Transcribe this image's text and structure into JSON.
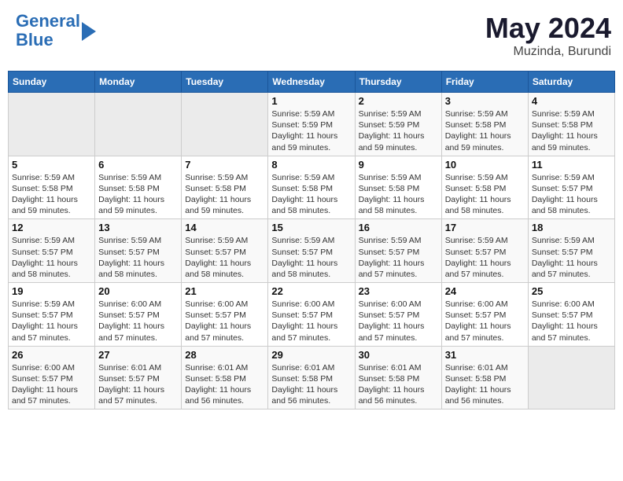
{
  "header": {
    "logo_line1": "General",
    "logo_line2": "Blue",
    "month_year": "May 2024",
    "location": "Muzinda, Burundi"
  },
  "days_of_week": [
    "Sunday",
    "Monday",
    "Tuesday",
    "Wednesday",
    "Thursday",
    "Friday",
    "Saturday"
  ],
  "weeks": [
    [
      {
        "day": "",
        "info": ""
      },
      {
        "day": "",
        "info": ""
      },
      {
        "day": "",
        "info": ""
      },
      {
        "day": "1",
        "info": "Sunrise: 5:59 AM\nSunset: 5:59 PM\nDaylight: 11 hours\nand 59 minutes."
      },
      {
        "day": "2",
        "info": "Sunrise: 5:59 AM\nSunset: 5:59 PM\nDaylight: 11 hours\nand 59 minutes."
      },
      {
        "day": "3",
        "info": "Sunrise: 5:59 AM\nSunset: 5:58 PM\nDaylight: 11 hours\nand 59 minutes."
      },
      {
        "day": "4",
        "info": "Sunrise: 5:59 AM\nSunset: 5:58 PM\nDaylight: 11 hours\nand 59 minutes."
      }
    ],
    [
      {
        "day": "5",
        "info": "Sunrise: 5:59 AM\nSunset: 5:58 PM\nDaylight: 11 hours\nand 59 minutes."
      },
      {
        "day": "6",
        "info": "Sunrise: 5:59 AM\nSunset: 5:58 PM\nDaylight: 11 hours\nand 59 minutes."
      },
      {
        "day": "7",
        "info": "Sunrise: 5:59 AM\nSunset: 5:58 PM\nDaylight: 11 hours\nand 59 minutes."
      },
      {
        "day": "8",
        "info": "Sunrise: 5:59 AM\nSunset: 5:58 PM\nDaylight: 11 hours\nand 58 minutes."
      },
      {
        "day": "9",
        "info": "Sunrise: 5:59 AM\nSunset: 5:58 PM\nDaylight: 11 hours\nand 58 minutes."
      },
      {
        "day": "10",
        "info": "Sunrise: 5:59 AM\nSunset: 5:58 PM\nDaylight: 11 hours\nand 58 minutes."
      },
      {
        "day": "11",
        "info": "Sunrise: 5:59 AM\nSunset: 5:57 PM\nDaylight: 11 hours\nand 58 minutes."
      }
    ],
    [
      {
        "day": "12",
        "info": "Sunrise: 5:59 AM\nSunset: 5:57 PM\nDaylight: 11 hours\nand 58 minutes."
      },
      {
        "day": "13",
        "info": "Sunrise: 5:59 AM\nSunset: 5:57 PM\nDaylight: 11 hours\nand 58 minutes."
      },
      {
        "day": "14",
        "info": "Sunrise: 5:59 AM\nSunset: 5:57 PM\nDaylight: 11 hours\nand 58 minutes."
      },
      {
        "day": "15",
        "info": "Sunrise: 5:59 AM\nSunset: 5:57 PM\nDaylight: 11 hours\nand 58 minutes."
      },
      {
        "day": "16",
        "info": "Sunrise: 5:59 AM\nSunset: 5:57 PM\nDaylight: 11 hours\nand 57 minutes."
      },
      {
        "day": "17",
        "info": "Sunrise: 5:59 AM\nSunset: 5:57 PM\nDaylight: 11 hours\nand 57 minutes."
      },
      {
        "day": "18",
        "info": "Sunrise: 5:59 AM\nSunset: 5:57 PM\nDaylight: 11 hours\nand 57 minutes."
      }
    ],
    [
      {
        "day": "19",
        "info": "Sunrise: 5:59 AM\nSunset: 5:57 PM\nDaylight: 11 hours\nand 57 minutes."
      },
      {
        "day": "20",
        "info": "Sunrise: 6:00 AM\nSunset: 5:57 PM\nDaylight: 11 hours\nand 57 minutes."
      },
      {
        "day": "21",
        "info": "Sunrise: 6:00 AM\nSunset: 5:57 PM\nDaylight: 11 hours\nand 57 minutes."
      },
      {
        "day": "22",
        "info": "Sunrise: 6:00 AM\nSunset: 5:57 PM\nDaylight: 11 hours\nand 57 minutes."
      },
      {
        "day": "23",
        "info": "Sunrise: 6:00 AM\nSunset: 5:57 PM\nDaylight: 11 hours\nand 57 minutes."
      },
      {
        "day": "24",
        "info": "Sunrise: 6:00 AM\nSunset: 5:57 PM\nDaylight: 11 hours\nand 57 minutes."
      },
      {
        "day": "25",
        "info": "Sunrise: 6:00 AM\nSunset: 5:57 PM\nDaylight: 11 hours\nand 57 minutes."
      }
    ],
    [
      {
        "day": "26",
        "info": "Sunrise: 6:00 AM\nSunset: 5:57 PM\nDaylight: 11 hours\nand 57 minutes."
      },
      {
        "day": "27",
        "info": "Sunrise: 6:01 AM\nSunset: 5:57 PM\nDaylight: 11 hours\nand 57 minutes."
      },
      {
        "day": "28",
        "info": "Sunrise: 6:01 AM\nSunset: 5:58 PM\nDaylight: 11 hours\nand 56 minutes."
      },
      {
        "day": "29",
        "info": "Sunrise: 6:01 AM\nSunset: 5:58 PM\nDaylight: 11 hours\nand 56 minutes."
      },
      {
        "day": "30",
        "info": "Sunrise: 6:01 AM\nSunset: 5:58 PM\nDaylight: 11 hours\nand 56 minutes."
      },
      {
        "day": "31",
        "info": "Sunrise: 6:01 AM\nSunset: 5:58 PM\nDaylight: 11 hours\nand 56 minutes."
      },
      {
        "day": "",
        "info": ""
      }
    ]
  ]
}
